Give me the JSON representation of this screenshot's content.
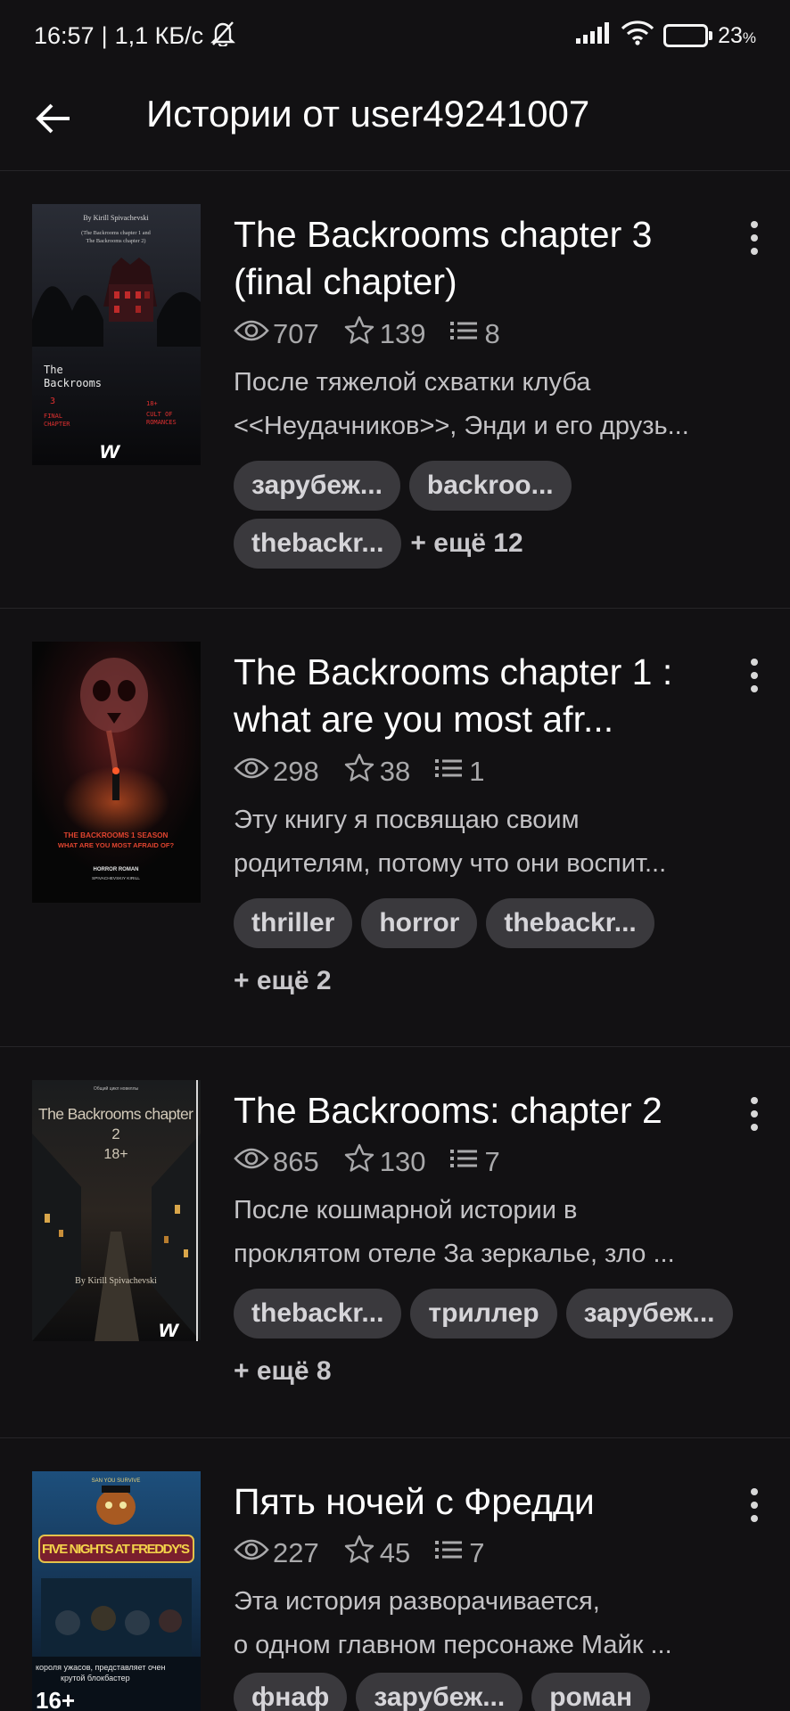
{
  "status_bar": {
    "time": "16:57",
    "network_speed": "1,1 КБ/с",
    "battery_percent": "23",
    "battery_unit": "%"
  },
  "header": {
    "title": "Истории от user49241007"
  },
  "stories": [
    {
      "title": "The Backrooms chapter 3 (final chapter)",
      "views": "707",
      "votes": "139",
      "parts": "8",
      "description_lines": [
        "После тяжелой схватки клуба",
        "<<Неудачников>>, Энди и его друзь..."
      ],
      "tags": [
        "зарубеж...",
        "backroo...",
        "thebackr..."
      ],
      "more_tags": "+ ещё 12",
      "cover": {
        "author": "By Kirill Spivachevski",
        "subtitle": "(The Backrooms chapter 1 and The Backrooms chapter 2)",
        "title_line1": "The",
        "title_line2": "Backrooms",
        "number": "3",
        "chapter_line1": "FINAL",
        "chapter_line2": "CHAPTER",
        "age": "18+",
        "cult_line1": "CULT OF",
        "cult_line2": "ROMANCES",
        "logo": "w"
      }
    },
    {
      "title": "The Backrooms chapter 1 : what are you most afr...",
      "views": "298",
      "votes": "38",
      "parts": "1",
      "description_lines": [
        "Эту книгу я посвящаю своим",
        "родителям, потому что они воспит..."
      ],
      "tags": [
        "thriller",
        "horror",
        "thebackr..."
      ],
      "more_tags": "+ ещё 2",
      "cover": {
        "title_line1": "THE BACKROOMS 1 SEASON",
        "title_line2": "WHAT ARE YOU MOST AFRAID OF?",
        "genre": "HORROR ROMAN",
        "author": "SPIVACHEVSKIY KIRILL"
      }
    },
    {
      "title": "The Backrooms: chapter 2",
      "views": "865",
      "votes": "130",
      "parts": "7",
      "description_lines": [
        "После кошмарной истории в",
        "проклятом отеле За зеркалье, зло ..."
      ],
      "tags": [
        "thebackr...",
        "триллер",
        "зарубеж..."
      ],
      "more_tags": "+ ещё 8",
      "cover": {
        "title_line1": "The Backrooms chapter",
        "title_line2": "2",
        "age": "18+",
        "author": "By Kirill Spivachevski",
        "logo": "w"
      }
    },
    {
      "title": "Пять ночей с Фредди",
      "views": "227",
      "votes": "45",
      "parts": "7",
      "description_lines": [
        "Эта история разворачивается,",
        "о одном главном персонаже Майк ..."
      ],
      "tags": [
        "фнаф",
        "зарубеж...",
        "роман"
      ],
      "more_tags": "",
      "cover": {
        "title": "FIVE NIGHTS AT FREDDY'S",
        "tagline_line1": "короля ужасов, представляет очен",
        "tagline_line2": "крутой блокбастер",
        "age": "16+"
      }
    }
  ],
  "colors": {
    "background": "#121113",
    "tag_background": "#3a393d",
    "muted_text": "#a9a9ab"
  },
  "icons": {
    "back": "arrow-left-icon",
    "views": "eye-icon",
    "votes": "star-icon",
    "parts": "list-icon",
    "menu": "more-vertical-icon",
    "signal": "signal-icon",
    "wifi": "wifi-icon",
    "mute": "bell-off-icon"
  }
}
